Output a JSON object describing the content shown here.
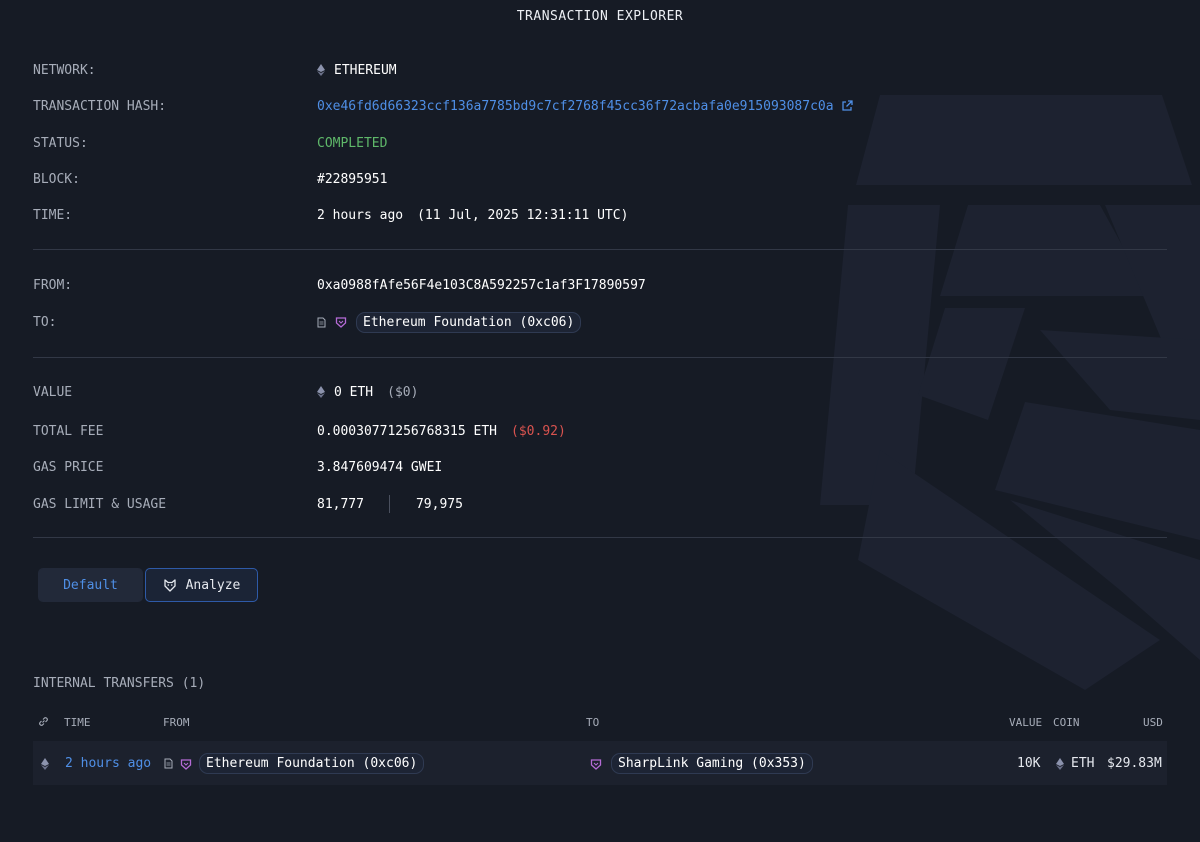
{
  "header": {
    "title": "TRANSACTION EXPLORER"
  },
  "details": {
    "network_label": "NETWORK:",
    "network_value": "ETHEREUM",
    "hash_label": "TRANSACTION HASH:",
    "hash_value": "0xe46fd6d66323ccf136a7785bd9c7cf2768f45cc36f72acbafa0e915093087c0a",
    "status_label": "STATUS:",
    "status_value": "COMPLETED",
    "block_label": "BLOCK:",
    "block_value": "#22895951",
    "time_label": "TIME:",
    "time_relative": "2 hours ago",
    "time_absolute": "(11 Jul, 2025 12:31:11 UTC)",
    "from_label": "FROM:",
    "from_value": "0xa0988fAfe56F4e103C8A592257c1af3F17890597",
    "to_label": "TO:",
    "to_value": "Ethereum Foundation (0xc06)",
    "value_label": "VALUE",
    "value_amount": "0 ETH",
    "value_usd": "($0)",
    "fee_label": "TOTAL FEE",
    "fee_amount": "0.00030771256768315 ETH",
    "fee_usd": "($0.92)",
    "gas_price_label": "GAS PRICE",
    "gas_price_value": "3.847609474 GWEI",
    "gas_limit_label": "GAS LIMIT & USAGE",
    "gas_limit_value": "81,777",
    "gas_usage_value": "79,975"
  },
  "tabs": {
    "default_label": "Default",
    "analyze_label": "Analyze",
    "active": "Analyze"
  },
  "internal_transfers": {
    "title": "INTERNAL TRANSFERS (1)",
    "columns": {
      "time": "TIME",
      "from": "FROM",
      "to": "TO",
      "value": "VALUE",
      "coin": "COIN",
      "usd": "USD"
    },
    "rows": [
      {
        "time": "2 hours ago",
        "from": "Ethereum Foundation (0xc06)",
        "to": "SharpLink Gaming (0x353)",
        "value": "10K",
        "coin": "ETH",
        "usd": "$29.83M"
      }
    ]
  },
  "colors": {
    "background": "#161b25",
    "link": "#4f8fe6",
    "success": "#5fb86a",
    "fee_usd": "#d9534f",
    "entity_tag": "#b56bd6",
    "eth_icon": "#8c93ad"
  },
  "icons": [
    "ethereum-icon",
    "external-link-icon",
    "contract-file-icon",
    "entity-tag-icon",
    "analyze-fox-icon",
    "link-chain-icon"
  ]
}
